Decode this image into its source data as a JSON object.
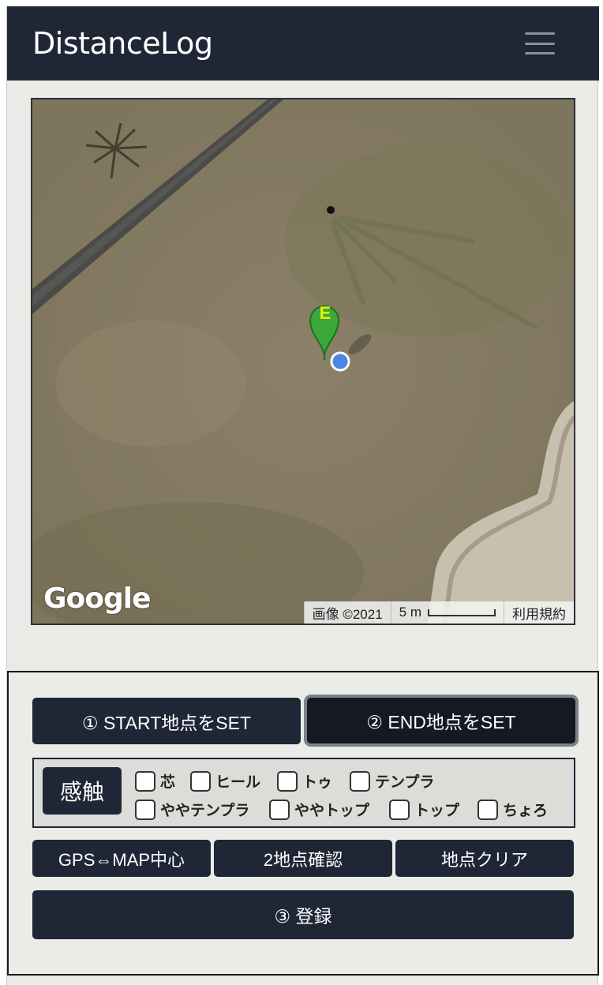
{
  "navbar": {
    "brand": "DistanceLog",
    "menu_icon": "hamburger-menu-icon"
  },
  "map": {
    "logo": "Google",
    "imagery_credit": "画像 ©2021",
    "scale_label": "5 m",
    "terms_label": "利用規約",
    "marker_label": "E",
    "marker_color": "#3aa83a",
    "location_dot_color": "#4c86e0"
  },
  "controls": {
    "start_button": "① START地点をSET",
    "end_button": "② END地点をSET",
    "sense_label": "感触",
    "feel_options": [
      "芯",
      "ヒール",
      "トゥ",
      "テンプラ",
      "ややテンプラ",
      "ややトップ",
      "トップ",
      "ちょろ"
    ],
    "gps_button": "GPS⇔MAP中心",
    "confirm_button": "2地点確認",
    "clear_button": "地点クリア",
    "register_button": "③ 登録"
  }
}
